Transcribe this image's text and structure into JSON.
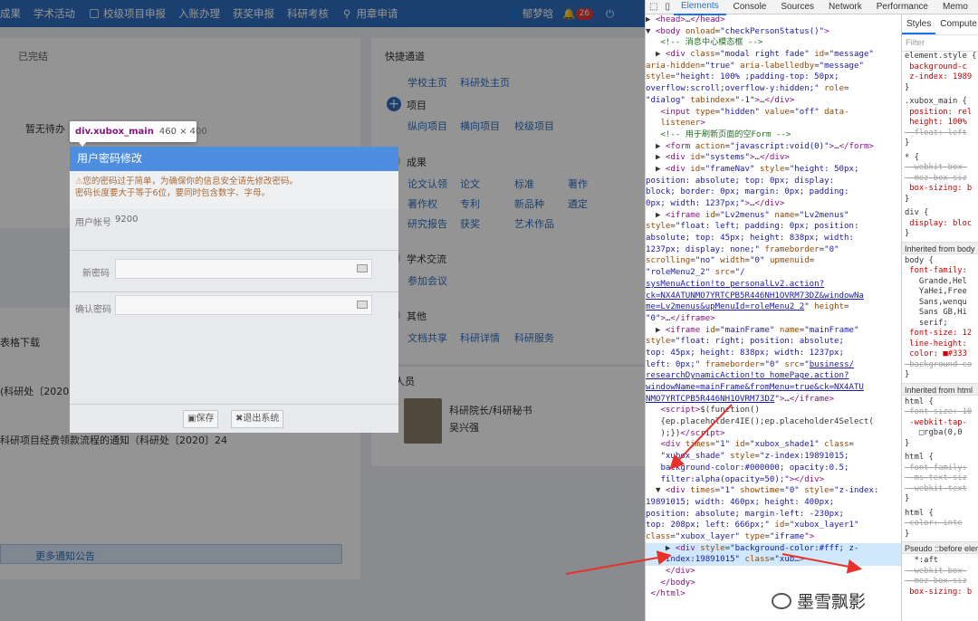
{
  "nav": {
    "items": [
      {
        "label": "成果"
      },
      {
        "label": "学术活动"
      },
      {
        "label": "校级项目申报"
      },
      {
        "label": "入账办理"
      },
      {
        "label": "获奖申报"
      },
      {
        "label": "科研考核"
      },
      {
        "label": "用章申请"
      }
    ],
    "user": "郁梦晗",
    "badge": "26"
  },
  "left": {
    "done": "已完结",
    "empty": "暂无待办",
    "download": "表格下载",
    "notice1": "(科研处〔2020〕",
    "notice2": "科研项目经费领款流程的通知（科研处〔2020〕24",
    "more": "更多通知公告"
  },
  "right": {
    "quick": "快捷通道",
    "school_home": "学校主页",
    "res_home": "科研处主页",
    "project": {
      "title": "项目",
      "links": [
        "纵向项目",
        "横向项目",
        "校级项目"
      ]
    },
    "results": {
      "title": "成果",
      "links": [
        "论文认领",
        "论文",
        "标准",
        "著作",
        "著作权",
        "专利",
        "新品种",
        "遴定",
        "研究报告",
        "获奖",
        "艺术作品"
      ]
    },
    "academic": {
      "title": "学术交流",
      "links": [
        "参加会议"
      ]
    },
    "other": {
      "title": "其他",
      "links": [
        "文档共享",
        "科研详情",
        "科研服务"
      ]
    },
    "manager": {
      "title": "理人员",
      "role": "科研院长/科研秘书",
      "name": "吴兴强"
    }
  },
  "dialog": {
    "title": "用户密码修改",
    "warning1": "您的密码过于简单，为确保你的信息安全请先修改密码。",
    "warning2": "密码长度要大于等于6位，要同时包含数字、字母。",
    "account_label": "用户帐号",
    "account_value": "9200",
    "new_label": "新密码",
    "confirm_label": "确认密码",
    "save": "保存",
    "exit": "退出系统"
  },
  "tooltip": {
    "selector": "div.xubox_main",
    "size": "460 × 400"
  },
  "devtools": {
    "tabs": [
      "Elements",
      "Console",
      "Sources",
      "Network",
      "Performance",
      "Memo"
    ],
    "styles_tabs": [
      "Styles",
      "Compute"
    ],
    "filter": "Filter",
    "watermark": "墨雪飘影"
  },
  "colors": {
    "nav": "#2f6fbf",
    "dialog_header": "#4d8ee0",
    "selected_line": "#cfe8fc",
    "arrow": "#e8312a"
  }
}
